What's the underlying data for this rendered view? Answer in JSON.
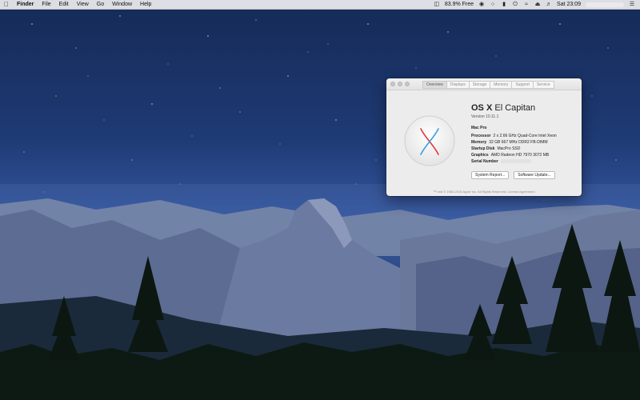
{
  "menubar": {
    "app_name": "Finder",
    "menus": [
      "File",
      "Edit",
      "View",
      "Go",
      "Window",
      "Help"
    ],
    "status": {
      "disk_free": "83.9% Free",
      "clock": "Sat 23:09"
    },
    "icons": [
      "apple-logo",
      "disk-icon",
      "record-icon",
      "circle-icon",
      "battery-icon",
      "power-icon",
      "wifi-icon",
      "eject-icon",
      "volume-icon",
      "notifications-list-icon"
    ]
  },
  "about_window": {
    "tabs": [
      "Overview",
      "Displays",
      "Storage",
      "Memory",
      "Support",
      "Service"
    ],
    "active_tab": "Overview",
    "os_name_bold": "OS X",
    "os_name_light": "El Capitan",
    "version": "Version 10.11.1",
    "model": "Mac Pro",
    "specs": [
      {
        "label": "Processor",
        "value": "2 x 2.66 GHz Quad-Core Intel Xeon"
      },
      {
        "label": "Memory",
        "value": "32 GB 667 MHz DDR2 FB-DIMM"
      },
      {
        "label": "Startup Disk",
        "value": "MacPro SSD"
      },
      {
        "label": "Graphics",
        "value": "AMD Radeon HD 7970 3072 MB"
      }
    ],
    "serial_label": "Serial Number",
    "buttons": {
      "system_report": "System Report...",
      "software_update": "Software Update..."
    },
    "copyright": "™ and © 1983-2015 Apple Inc. All Rights Reserved. License Agreement"
  },
  "colors": {
    "sky_top": "#152a56",
    "sky_mid": "#3557a0",
    "mountain": "#5a6b8f",
    "trees": "#0d1a14",
    "logo_blue": "#3aa0e0",
    "logo_red": "#e03a3a"
  }
}
